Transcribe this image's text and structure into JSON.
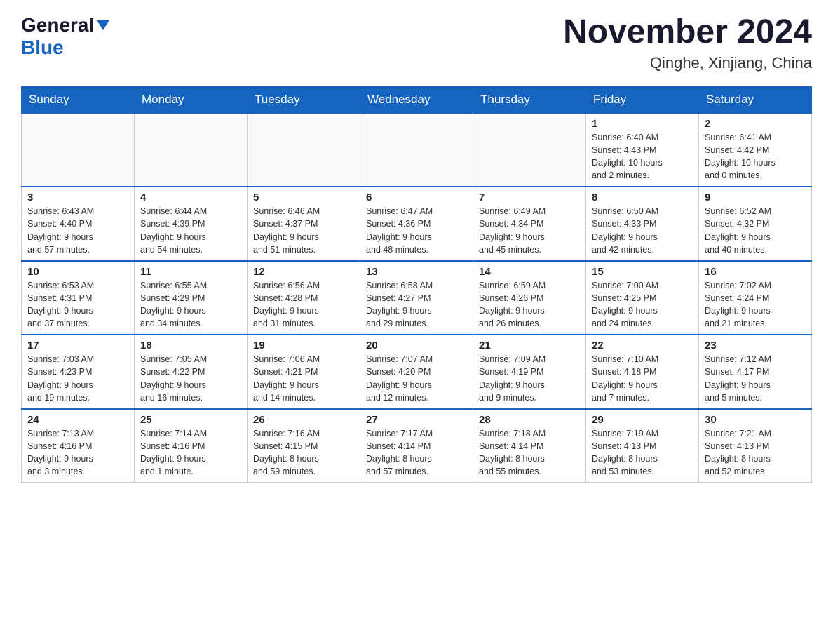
{
  "header": {
    "logo": {
      "general": "General",
      "blue": "Blue",
      "triangle": "▼"
    },
    "month_title": "November 2024",
    "subtitle": "Qinghe, Xinjiang, China"
  },
  "weekdays": [
    "Sunday",
    "Monday",
    "Tuesday",
    "Wednesday",
    "Thursday",
    "Friday",
    "Saturday"
  ],
  "weeks": [
    {
      "days": [
        {
          "num": "",
          "info": "",
          "empty": true
        },
        {
          "num": "",
          "info": "",
          "empty": true
        },
        {
          "num": "",
          "info": "",
          "empty": true
        },
        {
          "num": "",
          "info": "",
          "empty": true
        },
        {
          "num": "",
          "info": "",
          "empty": true
        },
        {
          "num": "1",
          "info": "Sunrise: 6:40 AM\nSunset: 4:43 PM\nDaylight: 10 hours\nand 2 minutes.",
          "empty": false
        },
        {
          "num": "2",
          "info": "Sunrise: 6:41 AM\nSunset: 4:42 PM\nDaylight: 10 hours\nand 0 minutes.",
          "empty": false
        }
      ]
    },
    {
      "days": [
        {
          "num": "3",
          "info": "Sunrise: 6:43 AM\nSunset: 4:40 PM\nDaylight: 9 hours\nand 57 minutes.",
          "empty": false
        },
        {
          "num": "4",
          "info": "Sunrise: 6:44 AM\nSunset: 4:39 PM\nDaylight: 9 hours\nand 54 minutes.",
          "empty": false
        },
        {
          "num": "5",
          "info": "Sunrise: 6:46 AM\nSunset: 4:37 PM\nDaylight: 9 hours\nand 51 minutes.",
          "empty": false
        },
        {
          "num": "6",
          "info": "Sunrise: 6:47 AM\nSunset: 4:36 PM\nDaylight: 9 hours\nand 48 minutes.",
          "empty": false
        },
        {
          "num": "7",
          "info": "Sunrise: 6:49 AM\nSunset: 4:34 PM\nDaylight: 9 hours\nand 45 minutes.",
          "empty": false
        },
        {
          "num": "8",
          "info": "Sunrise: 6:50 AM\nSunset: 4:33 PM\nDaylight: 9 hours\nand 42 minutes.",
          "empty": false
        },
        {
          "num": "9",
          "info": "Sunrise: 6:52 AM\nSunset: 4:32 PM\nDaylight: 9 hours\nand 40 minutes.",
          "empty": false
        }
      ]
    },
    {
      "days": [
        {
          "num": "10",
          "info": "Sunrise: 6:53 AM\nSunset: 4:31 PM\nDaylight: 9 hours\nand 37 minutes.",
          "empty": false
        },
        {
          "num": "11",
          "info": "Sunrise: 6:55 AM\nSunset: 4:29 PM\nDaylight: 9 hours\nand 34 minutes.",
          "empty": false
        },
        {
          "num": "12",
          "info": "Sunrise: 6:56 AM\nSunset: 4:28 PM\nDaylight: 9 hours\nand 31 minutes.",
          "empty": false
        },
        {
          "num": "13",
          "info": "Sunrise: 6:58 AM\nSunset: 4:27 PM\nDaylight: 9 hours\nand 29 minutes.",
          "empty": false
        },
        {
          "num": "14",
          "info": "Sunrise: 6:59 AM\nSunset: 4:26 PM\nDaylight: 9 hours\nand 26 minutes.",
          "empty": false
        },
        {
          "num": "15",
          "info": "Sunrise: 7:00 AM\nSunset: 4:25 PM\nDaylight: 9 hours\nand 24 minutes.",
          "empty": false
        },
        {
          "num": "16",
          "info": "Sunrise: 7:02 AM\nSunset: 4:24 PM\nDaylight: 9 hours\nand 21 minutes.",
          "empty": false
        }
      ]
    },
    {
      "days": [
        {
          "num": "17",
          "info": "Sunrise: 7:03 AM\nSunset: 4:23 PM\nDaylight: 9 hours\nand 19 minutes.",
          "empty": false
        },
        {
          "num": "18",
          "info": "Sunrise: 7:05 AM\nSunset: 4:22 PM\nDaylight: 9 hours\nand 16 minutes.",
          "empty": false
        },
        {
          "num": "19",
          "info": "Sunrise: 7:06 AM\nSunset: 4:21 PM\nDaylight: 9 hours\nand 14 minutes.",
          "empty": false
        },
        {
          "num": "20",
          "info": "Sunrise: 7:07 AM\nSunset: 4:20 PM\nDaylight: 9 hours\nand 12 minutes.",
          "empty": false
        },
        {
          "num": "21",
          "info": "Sunrise: 7:09 AM\nSunset: 4:19 PM\nDaylight: 9 hours\nand 9 minutes.",
          "empty": false
        },
        {
          "num": "22",
          "info": "Sunrise: 7:10 AM\nSunset: 4:18 PM\nDaylight: 9 hours\nand 7 minutes.",
          "empty": false
        },
        {
          "num": "23",
          "info": "Sunrise: 7:12 AM\nSunset: 4:17 PM\nDaylight: 9 hours\nand 5 minutes.",
          "empty": false
        }
      ]
    },
    {
      "days": [
        {
          "num": "24",
          "info": "Sunrise: 7:13 AM\nSunset: 4:16 PM\nDaylight: 9 hours\nand 3 minutes.",
          "empty": false
        },
        {
          "num": "25",
          "info": "Sunrise: 7:14 AM\nSunset: 4:16 PM\nDaylight: 9 hours\nand 1 minute.",
          "empty": false
        },
        {
          "num": "26",
          "info": "Sunrise: 7:16 AM\nSunset: 4:15 PM\nDaylight: 8 hours\nand 59 minutes.",
          "empty": false
        },
        {
          "num": "27",
          "info": "Sunrise: 7:17 AM\nSunset: 4:14 PM\nDaylight: 8 hours\nand 57 minutes.",
          "empty": false
        },
        {
          "num": "28",
          "info": "Sunrise: 7:18 AM\nSunset: 4:14 PM\nDaylight: 8 hours\nand 55 minutes.",
          "empty": false
        },
        {
          "num": "29",
          "info": "Sunrise: 7:19 AM\nSunset: 4:13 PM\nDaylight: 8 hours\nand 53 minutes.",
          "empty": false
        },
        {
          "num": "30",
          "info": "Sunrise: 7:21 AM\nSunset: 4:13 PM\nDaylight: 8 hours\nand 52 minutes.",
          "empty": false
        }
      ]
    }
  ]
}
